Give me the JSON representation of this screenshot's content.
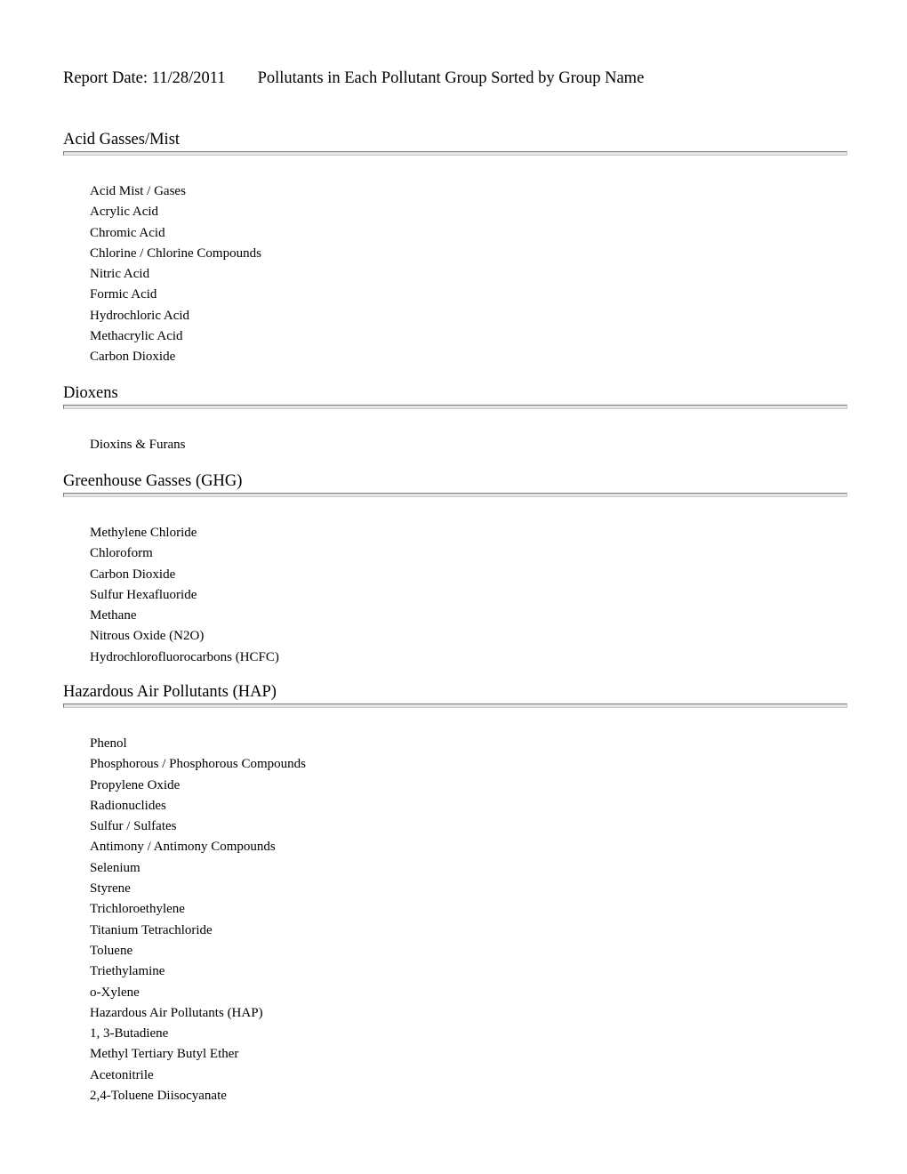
{
  "report": {
    "date_label": "Report Date: 11/28/2011",
    "title": "Pollutants in Each Pollutant Group Sorted by Group Name"
  },
  "groups": [
    {
      "name": "Acid Gasses/Mist",
      "items": [
        "Acid Mist / Gases",
        "Acrylic Acid",
        "Chromic Acid",
        "Chlorine / Chlorine Compounds",
        "Nitric Acid",
        "Formic Acid",
        "Hydrochloric Acid",
        "Methacrylic Acid",
        "Carbon Dioxide"
      ]
    },
    {
      "name": "Dioxens",
      "items": [
        "Dioxins & Furans"
      ]
    },
    {
      "name": "Greenhouse Gasses (GHG)",
      "items": [
        "Methylene Chloride",
        "Chloroform",
        "Carbon Dioxide",
        "Sulfur Hexafluoride",
        "Methane",
        "Nitrous Oxide (N2O)",
        "Hydrochlorofluorocarbons (HCFC)"
      ]
    },
    {
      "name": "Hazardous Air Pollutants (HAP)",
      "items": [
        "Phenol",
        "Phosphorous / Phosphorous Compounds",
        "Propylene Oxide",
        "Radionuclides",
        "Sulfur / Sulfates",
        "Antimony / Antimony Compounds",
        "Selenium",
        "Styrene",
        "Trichloroethylene",
        "Titanium Tetrachloride",
        "Toluene",
        "Triethylamine",
        "o-Xylene",
        "Hazardous Air Pollutants (HAP)",
        "1, 3-Butadiene",
        "Methyl Tertiary Butyl Ether",
        "Acetonitrile",
        "2,4-Toluene Diisocyanate"
      ]
    }
  ]
}
